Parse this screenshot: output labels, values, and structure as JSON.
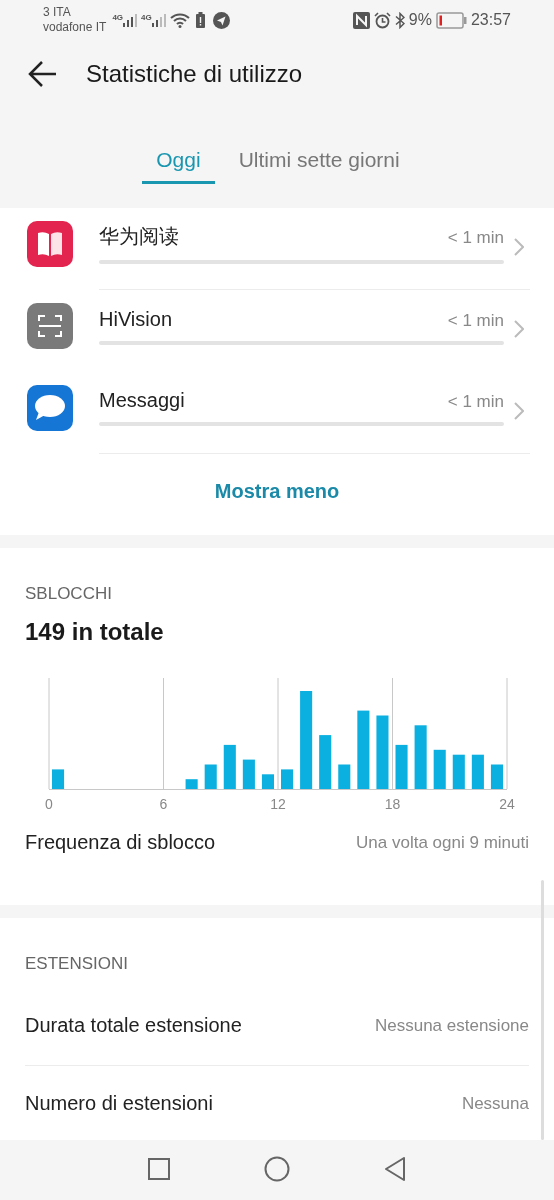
{
  "status_bar": {
    "carrier_1": "3 ITA",
    "carrier_2": "vodafone IT",
    "network_1": "4G",
    "network_2": "4G",
    "battery_percent": "9%",
    "time": "23:57"
  },
  "header": {
    "title": "Statistiche di utilizzo"
  },
  "tabs": [
    {
      "label": "Oggi",
      "selected": true
    },
    {
      "label": "Ultimi sette giorni",
      "selected": false
    }
  ],
  "apps": [
    {
      "name": "华为阅读",
      "time": "< 1 min"
    },
    {
      "name": "HiVision",
      "time": "< 1 min"
    },
    {
      "name": "Messaggi",
      "time": "< 1 min"
    }
  ],
  "show_less": "Mostra meno",
  "unlocks": {
    "heading": "SBLOCCHI",
    "total": "149 in totale",
    "x_labels": [
      "0",
      "6",
      "12",
      "18",
      "24"
    ],
    "frequency_label": "Frequenza di sblocco",
    "frequency_value": "Una volta ogni 9 minuti"
  },
  "extensions": {
    "heading": "ESTENSIONI",
    "rows": [
      {
        "label": "Durata totale estensione",
        "value": "Nessuna estensione"
      },
      {
        "label": "Numero di estensioni",
        "value": "Nessuna"
      }
    ]
  }
}
